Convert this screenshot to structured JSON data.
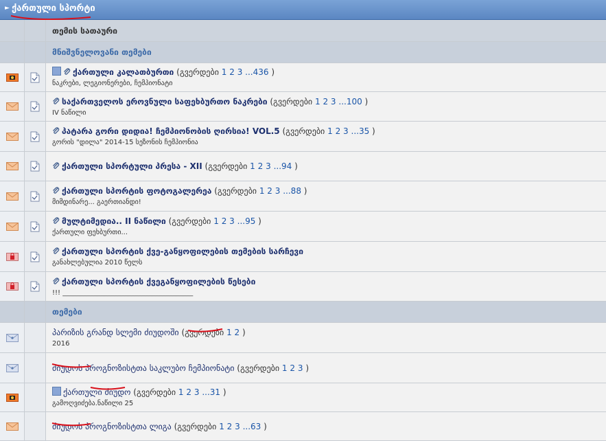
{
  "forum": {
    "title": "ქართული სპორტი"
  },
  "columns": {
    "topic_title": "თემის სათაური"
  },
  "sections": {
    "important": "მნიშვნელოვანი თემები",
    "topics": "თემები"
  },
  "pages_label": "გვერდები",
  "important_topics": [
    {
      "icon": "hot-envelope",
      "title": "ქართული კალათბურთი",
      "pages": [
        "1",
        "2",
        "3",
        "...436"
      ],
      "desc": "ნაკრები, ლეგიონერები, ჩემპიონატი",
      "mini": true,
      "clip": true
    },
    {
      "icon": "envelope",
      "title": "საქართველოს ეროვნული საფეხბურთო ნაკრები",
      "pages": [
        "1",
        "2",
        "3",
        "...100"
      ],
      "desc": "IV ნაწილი",
      "mini": false,
      "clip": true
    },
    {
      "icon": "envelope",
      "title": "პატარა გორი დიდია! ჩემპიონობის ღირსია! VOL.5",
      "pages": [
        "1",
        "2",
        "3",
        "...35"
      ],
      "desc": "გორის \"დილა\" 2014-15 სეზონის ჩემპიონია",
      "mini": false,
      "clip": true
    },
    {
      "icon": "envelope",
      "title": "ქართული სპორტული პრესა - XII",
      "pages": [
        "1",
        "2",
        "3",
        "...94"
      ],
      "desc": "",
      "mini": false,
      "clip": true
    },
    {
      "icon": "envelope",
      "title": "ქართული სპორტის ფოტოგალერეა",
      "pages": [
        "1",
        "2",
        "3",
        "...88"
      ],
      "desc": "მიმდინარე... გაერთიანდი!",
      "mini": false,
      "clip": true
    },
    {
      "icon": "envelope",
      "title": "მულტიმედია.. II ნაწილი",
      "pages": [
        "1",
        "2",
        "3",
        "...95"
      ],
      "desc": "ქართული ფეხბურთი...",
      "mini": false,
      "clip": true
    },
    {
      "icon": "locked-envelope",
      "title": "ქართული სპორტის ქვე-განყოფილების თემების სარჩევი",
      "pages": [],
      "desc": "განახლებულია 2010 წელს",
      "mini": false,
      "clip": true
    },
    {
      "icon": "locked-envelope",
      "title": "ქართული სპორტის ქვეგანყოფილების წესები",
      "pages": [],
      "desc": "!!! ______________________________________",
      "mini": false,
      "clip": true
    }
  ],
  "topics": [
    {
      "icon": "plain-envelope",
      "title": "პარიზის გრანდ სლემი ძიუდოში",
      "pages": [
        "1",
        "2"
      ],
      "desc": "2016",
      "mini": false
    },
    {
      "icon": "plain-envelope",
      "title": "ძიუდოს პროგნოზისტთა საკლუბო ჩემპიონატი",
      "pages": [
        "1",
        "2",
        "3"
      ],
      "desc": "",
      "mini": false
    },
    {
      "icon": "hot-envelope",
      "title": "ქართული ძიუდო",
      "pages": [
        "1",
        "2",
        "3",
        "...31"
      ],
      "desc": "გამოღვიძება.ნაწილი 25",
      "mini": true
    },
    {
      "icon": "envelope",
      "title": "ძიუდოს პროგნოზისტთა ლიგა",
      "pages": [
        "1",
        "2",
        "3",
        "...63"
      ],
      "desc": "",
      "mini": false
    }
  ]
}
